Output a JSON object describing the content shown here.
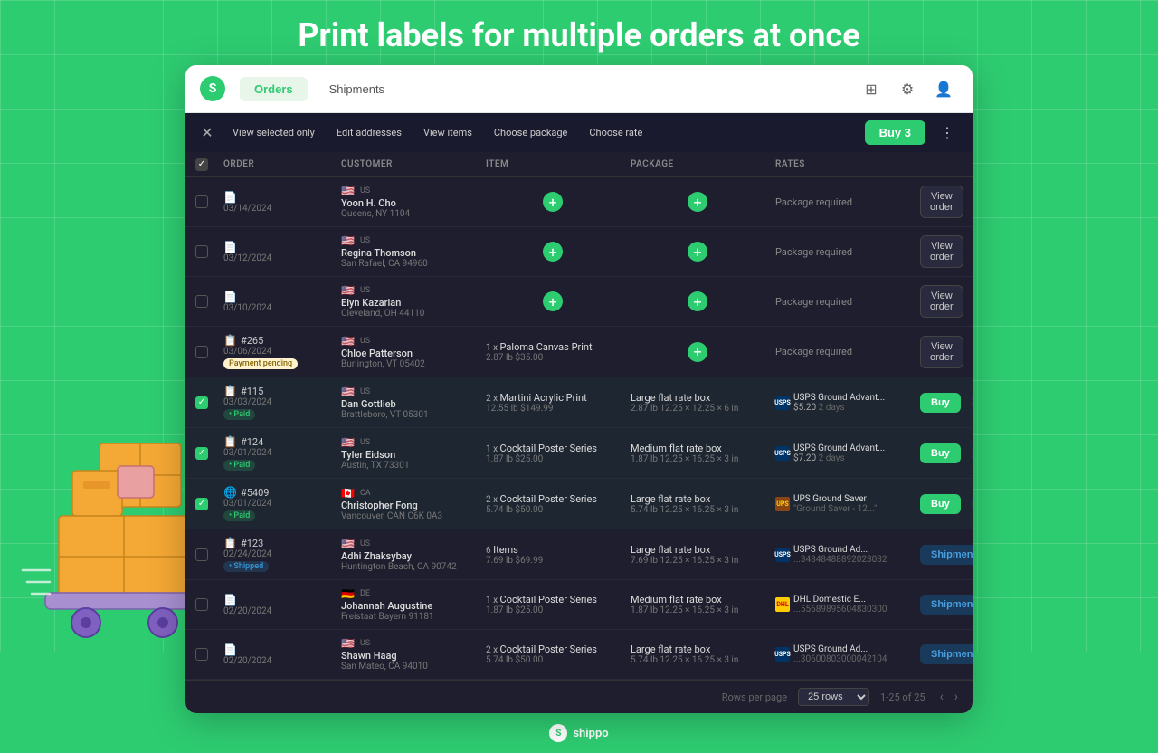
{
  "hero": {
    "title": "Print labels for multiple orders at once"
  },
  "nav": {
    "tabs": [
      {
        "label": "Orders",
        "active": true
      },
      {
        "label": "Shipments",
        "active": false
      }
    ],
    "icons": [
      "grid-icon",
      "settings-icon",
      "user-icon"
    ]
  },
  "toolbar": {
    "close_label": "×",
    "view_selected": "View selected only",
    "edit_addresses": "Edit addresses",
    "view_items": "View items",
    "choose_package": "Choose package",
    "choose_rate": "Choose rate",
    "buy_label": "Buy 3"
  },
  "columns": {
    "order": "ORDER",
    "customer": "CUSTOMER",
    "item": "ITEM",
    "package": "PACKAGE",
    "rates": "RATES"
  },
  "rows": [
    {
      "checked": false,
      "order_num": "",
      "order_date": "03/14/2024",
      "flag": "🇺🇸",
      "country": "US",
      "customer_name": "Yoon H. Cho",
      "customer_loc": "Queens, NY 1104",
      "item_qty": "",
      "item_name": "",
      "package": "Package required",
      "rate": "",
      "action": "View order",
      "action_type": "view",
      "badge": ""
    },
    {
      "checked": false,
      "order_num": "",
      "order_date": "03/12/2024",
      "flag": "🇺🇸",
      "country": "US",
      "customer_name": "Regina Thomson",
      "customer_loc": "San Rafael, CA 94960",
      "item_qty": "",
      "item_name": "",
      "package": "Package required",
      "rate": "",
      "action": "View order",
      "action_type": "view",
      "badge": ""
    },
    {
      "checked": false,
      "order_num": "",
      "order_date": "03/10/2024",
      "flag": "🇺🇸",
      "country": "US",
      "customer_name": "Elyn Kazarian",
      "customer_loc": "Cleveland, OH 44110",
      "item_qty": "",
      "item_name": "",
      "package": "Package required",
      "rate": "",
      "action": "View order",
      "action_type": "view",
      "badge": ""
    },
    {
      "checked": false,
      "order_num": "#265",
      "order_date": "03/06/2024",
      "flag": "🇺🇸",
      "country": "US",
      "customer_name": "Chloe Patterson",
      "customer_loc": "Burlington, VT 05402",
      "item_qty": "1 x",
      "item_name": "Paloma Canvas Print",
      "item_weight": "2.87 lb",
      "item_price": "$35.00",
      "package": "Package required",
      "rate": "",
      "action": "View order",
      "action_type": "view",
      "badge": "Payment pending"
    },
    {
      "checked": true,
      "order_num": "#115",
      "order_date": "03/03/2024",
      "flag": "🇺🇸",
      "country": "US",
      "customer_name": "Dan Gottlieb",
      "customer_loc": "Brattleboro, VT 05301",
      "item_qty": "2 x",
      "item_name": "Martini Acrylic Print",
      "item_weight": "12.55 lb",
      "item_price": "$149.99",
      "package_name": "Large flat rate box",
      "package_dims": "2.87 lb  12.25 × 12.25 × 6 in",
      "carrier": "usps",
      "rate_name": "USPS Ground Advant...",
      "rate_price": "$5.20",
      "rate_days": "2 days",
      "action": "Buy",
      "action_type": "buy",
      "badge": "Paid"
    },
    {
      "checked": true,
      "order_num": "#124",
      "order_date": "03/01/2024",
      "flag": "🇺🇸",
      "country": "US",
      "customer_name": "Tyler Eidson",
      "customer_loc": "Austin, TX 73301",
      "item_qty": "1 x",
      "item_name": "Cocktail Poster Series",
      "item_weight": "1.87 lb",
      "item_price": "$25.00",
      "package_name": "Medium flat rate box",
      "package_dims": "1.87 lb  12.25 × 16.25 × 3 in",
      "carrier": "usps",
      "rate_name": "USPS Ground Advant...",
      "rate_price": "$7.20",
      "rate_days": "2 days",
      "action": "Buy",
      "action_type": "buy",
      "badge": "Paid"
    },
    {
      "checked": true,
      "order_num": "#5409",
      "order_date": "03/01/2024",
      "flag": "🇨🇦",
      "country": "CA",
      "customer_name": "Christopher Fong",
      "customer_loc": "Vancouver, CAN C6K 0A3",
      "item_qty": "2 x",
      "item_name": "Cocktail Poster Series",
      "item_weight": "5.74 lb",
      "item_price": "$50.00",
      "package_name": "Large flat rate box",
      "package_dims": "5.74 lb  12.25 × 16.25 × 3 in",
      "carrier": "ups",
      "rate_name": "UPS Ground Saver",
      "rate_subname": "\"Ground Saver - 12...\"",
      "rate_price": "",
      "rate_days": "",
      "action": "Buy",
      "action_type": "buy",
      "badge": "Paid"
    },
    {
      "checked": false,
      "order_num": "#123",
      "order_date": "02/24/2024",
      "flag": "🇺🇸",
      "country": "US",
      "customer_name": "Adhi Zhaksybay",
      "customer_loc": "Huntington Beach, CA 90742",
      "item_qty": "6",
      "item_name": "Items",
      "item_weight": "7.69 lb",
      "item_price": "$69.99",
      "package_name": "Large flat rate box",
      "package_dims": "7.69 lb  12.25 × 16.25 × 3 in",
      "carrier": "usps",
      "rate_name": "USPS Ground Ad...",
      "rate_tracking": "...34848488892023032",
      "action": "Shipment",
      "action_type": "shipment",
      "badge": "Shipped"
    },
    {
      "checked": false,
      "order_num": "",
      "order_date": "02/20/2024",
      "flag": "🇩🇪",
      "country": "DE",
      "customer_name": "Johannah Augustine",
      "customer_loc": "Freistaat Bayern 91181",
      "item_qty": "1 x",
      "item_name": "Cocktail Poster Series",
      "item_weight": "1.87 lb",
      "item_price": "$25.00",
      "package_name": "Medium flat rate box",
      "package_dims": "1.87 lb  12.25 × 16.25 × 3 in",
      "carrier": "dhl",
      "rate_name": "DHL Domestic E...",
      "rate_tracking": "...55689895604830300",
      "action": "Shipment",
      "action_type": "shipment",
      "badge": ""
    },
    {
      "checked": false,
      "order_num": "",
      "order_date": "02/20/2024",
      "flag": "🇺🇸",
      "country": "US",
      "customer_name": "Shawn Haag",
      "customer_loc": "San Mateo, CA 94010",
      "item_qty": "2 x",
      "item_name": "Cocktail Poster Series",
      "item_weight": "5.74 lb",
      "item_price": "$50.00",
      "package_name": "Large flat rate box",
      "package_dims": "5.74 lb  12.25 × 16.25 × 3 in",
      "carrier": "usps",
      "rate_name": "USPS Ground Ad...",
      "rate_tracking": "...30600803000042104",
      "action": "Shipment",
      "action_type": "shipment",
      "badge": ""
    }
  ],
  "footer": {
    "rows_label": "Rows per page",
    "rows_value": "25 rows",
    "page_range": "1-25 of 25"
  },
  "shippo_footer": {
    "label": "shippo"
  }
}
